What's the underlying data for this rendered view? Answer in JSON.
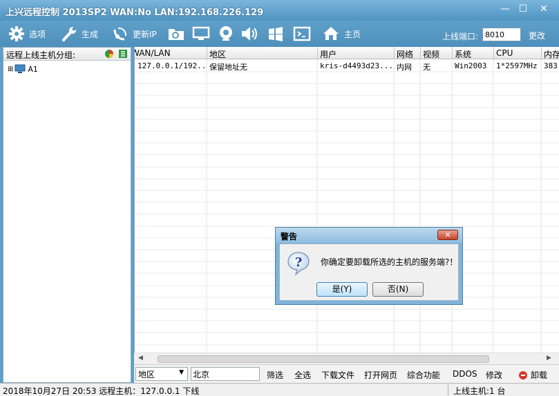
{
  "window": {
    "title": "上兴远程控制 2013SP2 WAN:No LAN:192.168.226.129",
    "minimize": "—",
    "maximize": "☐",
    "close": "✕"
  },
  "toolbar": {
    "items": [
      {
        "label": "选项",
        "icon": "gear-icon"
      },
      {
        "label": "生成",
        "icon": "wrench-icon"
      },
      {
        "label": "更新IP",
        "icon": "satellite-icon"
      },
      {
        "label": "",
        "icon": "file-search-icon"
      },
      {
        "label": "",
        "icon": "monitor-icon"
      },
      {
        "label": "",
        "icon": "webcam-icon"
      },
      {
        "label": "",
        "icon": "speaker-icon"
      },
      {
        "label": "",
        "icon": "windows-icon"
      },
      {
        "label": "",
        "icon": "terminal-icon"
      },
      {
        "label": "主页",
        "icon": "home-icon"
      }
    ],
    "port_label": "上线端口:",
    "port_value": "8010",
    "change_label": "更改"
  },
  "left_panel": {
    "header": "远程上线主机分组:",
    "tree": [
      {
        "expander": "⊞",
        "label": "A1"
      }
    ]
  },
  "grid": {
    "columns": [
      "WAN/LAN",
      "地区",
      "用户",
      "网络",
      "视频",
      "系统",
      "CPU",
      "内存"
    ],
    "rows": [
      [
        "127.0.0.1/192...",
        "保留地址无",
        "kris-d4493d23...",
        "内网",
        "无",
        "Win2003",
        "1*2597MHz",
        "383"
      ]
    ]
  },
  "filterbar": {
    "select_value": "地区",
    "input_value": "北京",
    "buttons": [
      "筛选",
      "全选",
      "下载文件",
      "打开网页",
      "综合功能",
      "DDOS",
      "修改"
    ],
    "uninstall_label": "卸载"
  },
  "statusbar": {
    "left": "2018年10月27日 20:53 远程主机：127.0.0.1 下线",
    "right": "上线主机:1 台"
  },
  "dialog": {
    "title": "警告",
    "close": "✕",
    "message": "你确定要卸载所选的主机的服务端?！",
    "yes_label": "是(Y)",
    "no_label": "否(N)"
  },
  "colors": {
    "titlebar": "#5f9fc8",
    "window_border": "#5f9fc8",
    "dialog_frame": "#7fb3d8",
    "close_button": "#c6432a"
  }
}
